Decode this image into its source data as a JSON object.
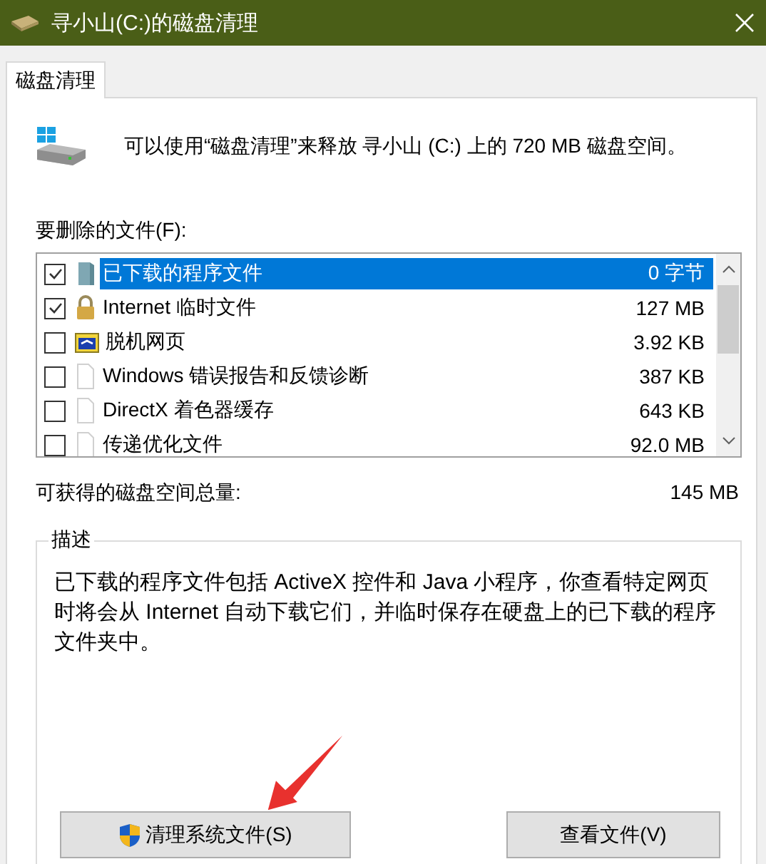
{
  "window": {
    "title": "寻小山(C:)的磁盘清理"
  },
  "tabs": [
    {
      "label": "磁盘清理",
      "selected": true
    }
  ],
  "header": {
    "text": "可以使用“磁盘清理”来释放 寻小山 (C:) 上的 720 MB 磁盘空间。"
  },
  "files_label": "要删除的文件(F):",
  "files": [
    {
      "name": "已下载的程序文件",
      "size": "0 字节",
      "checked": true,
      "selected": true,
      "kind": "folder"
    },
    {
      "name": "Internet 临时文件",
      "size": "127 MB",
      "checked": true,
      "selected": false,
      "kind": "lock"
    },
    {
      "name": "脱机网页",
      "size": "3.92 KB",
      "checked": false,
      "selected": false,
      "kind": "sync"
    },
    {
      "name": "Windows 错误报告和反馈诊断",
      "size": "387 KB",
      "checked": false,
      "selected": false,
      "kind": "page"
    },
    {
      "name": "DirectX 着色器缓存",
      "size": "643 KB",
      "checked": false,
      "selected": false,
      "kind": "page"
    },
    {
      "name": "传递优化文件",
      "size": "92.0 MB",
      "checked": false,
      "selected": false,
      "kind": "page"
    }
  ],
  "total": {
    "label": "可获得的磁盘空间总量:",
    "value": "145 MB"
  },
  "description": {
    "title": "描述",
    "text": "已下载的程序文件包括 ActiveX 控件和 Java 小程序，你查看特定网页时将会从 Internet 自动下载它们，并临时保存在硬盘上的已下载的程序文件夹中。"
  },
  "buttons": [
    {
      "label": "清理系统文件(S)",
      "kind": "shield"
    },
    {
      "label": "查看文件(V)",
      "kind": "plain"
    }
  ]
}
